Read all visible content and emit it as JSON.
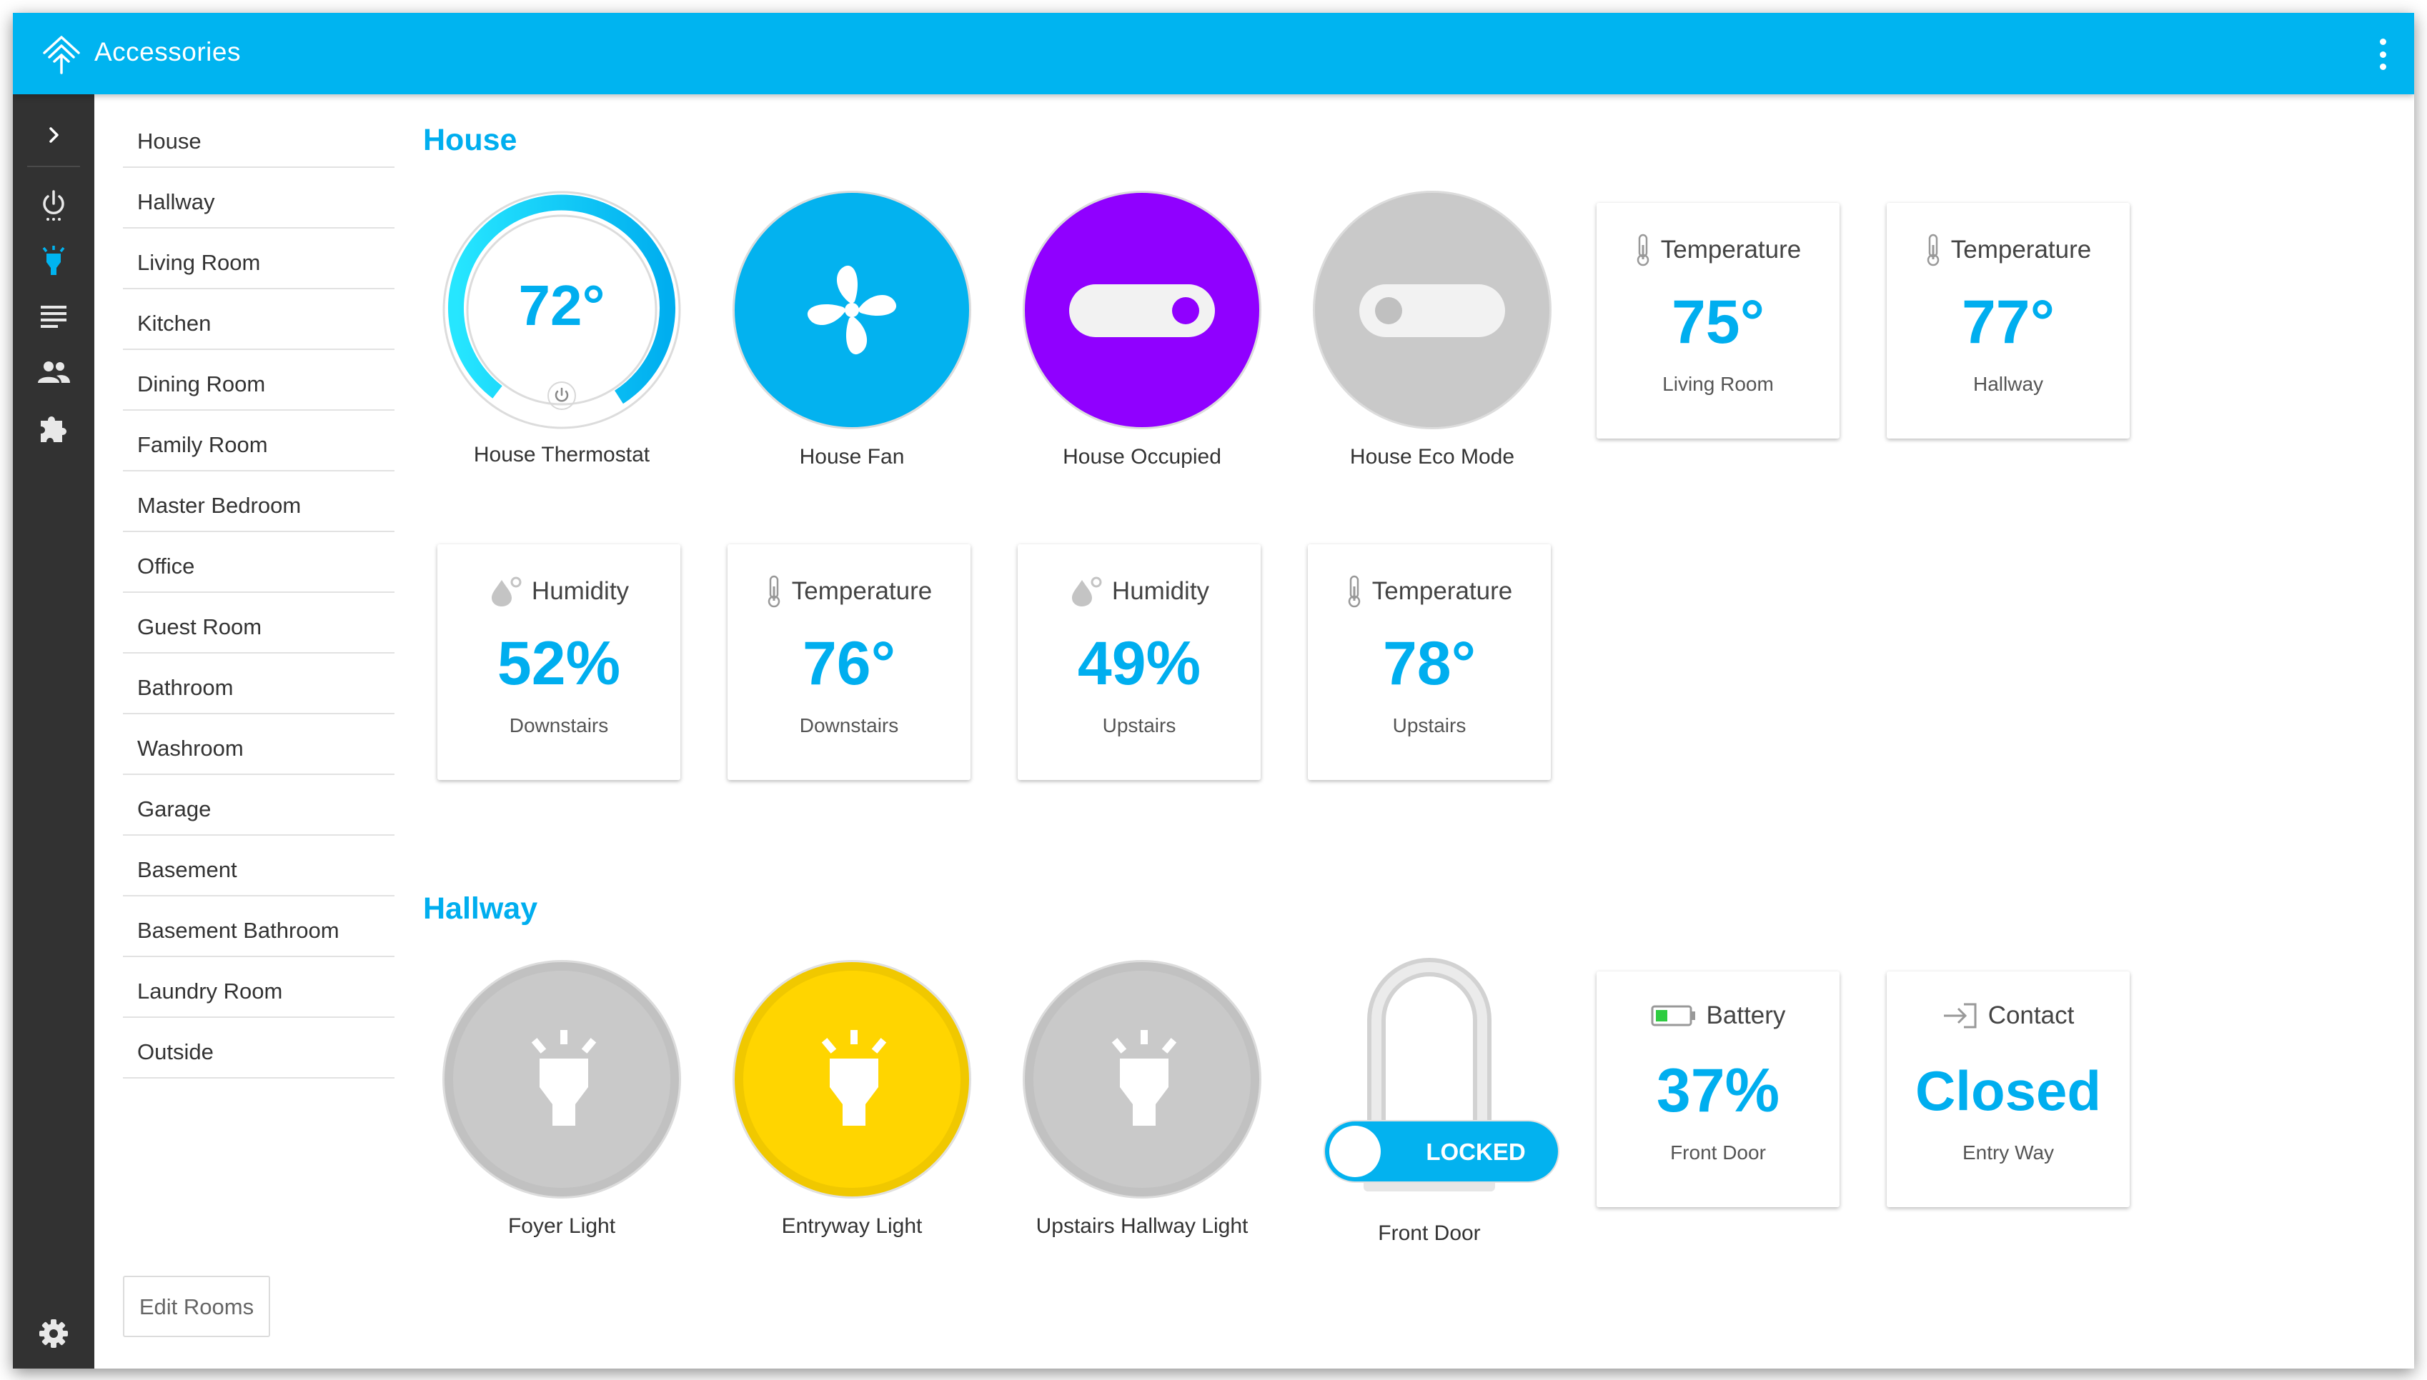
{
  "app": {
    "title": "Accessories"
  },
  "rail": {
    "items": [
      {
        "icon": "expand-chevron-icon"
      },
      {
        "icon": "power-icon"
      },
      {
        "icon": "accessories-icon",
        "active": true
      },
      {
        "icon": "log-list-icon"
      },
      {
        "icon": "users-icon"
      },
      {
        "icon": "plugins-icon"
      },
      {
        "icon": "settings-gear-icon"
      }
    ]
  },
  "rooms": {
    "items": [
      "House",
      "Hallway",
      "Living Room",
      "Kitchen",
      "Dining Room",
      "Family Room",
      "Master Bedroom",
      "Office",
      "Guest Room",
      "Bathroom",
      "Washroom",
      "Garage",
      "Basement",
      "Basement Bathroom",
      "Laundry Room",
      "Outside"
    ],
    "edit_label": "Edit Rooms"
  },
  "colors": {
    "accent": "#00b4f0",
    "purple": "#9000ff",
    "yellow": "#ffd500",
    "grey": "#c9c9c9",
    "rail": "#323232"
  },
  "house": {
    "title": "House",
    "thermostat": {
      "value": "72°",
      "label": "House Thermostat",
      "level": 0.72
    },
    "fan": {
      "label": "House Fan",
      "state": "on"
    },
    "occupied": {
      "label": "House Occupied",
      "state": "on"
    },
    "eco": {
      "label": "House Eco Mode",
      "state": "off"
    },
    "temp_living": {
      "head": "Temperature",
      "value": "75°",
      "sub": "Living Room"
    },
    "temp_hallway": {
      "head": "Temperature",
      "value": "77°",
      "sub": "Hallway"
    },
    "hum_down": {
      "head": "Humidity",
      "value": "52%",
      "sub": "Downstairs"
    },
    "temp_down": {
      "head": "Temperature",
      "value": "76°",
      "sub": "Downstairs"
    },
    "hum_up": {
      "head": "Humidity",
      "value": "49%",
      "sub": "Upstairs"
    },
    "temp_up": {
      "head": "Temperature",
      "value": "78°",
      "sub": "Upstairs"
    }
  },
  "hallway": {
    "title": "Hallway",
    "foyer": {
      "label": "Foyer Light",
      "state": "off"
    },
    "entryway": {
      "label": "Entryway Light",
      "state": "on"
    },
    "upstairs": {
      "label": "Upstairs Hallway Light",
      "state": "off"
    },
    "door": {
      "label": "Front Door",
      "lock_text": "LOCKED"
    },
    "battery": {
      "head": "Battery",
      "value": "37%",
      "sub": "Front Door",
      "level": 0.37
    },
    "contact": {
      "head": "Contact",
      "value": "Closed",
      "sub": "Entry Way"
    }
  }
}
